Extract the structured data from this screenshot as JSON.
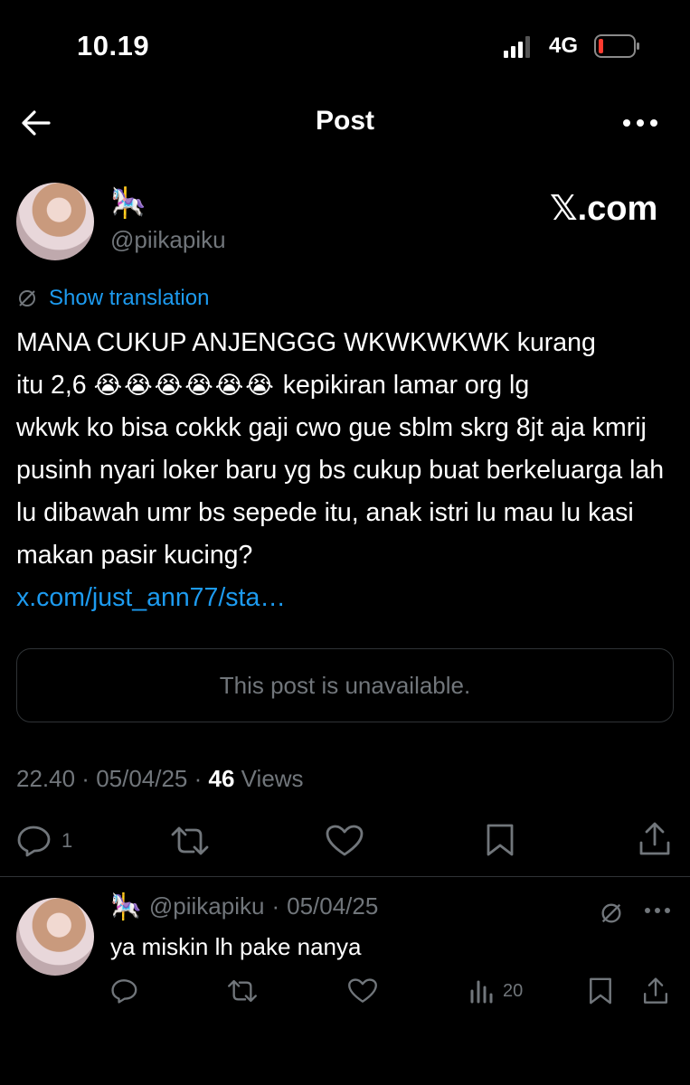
{
  "status_bar": {
    "time": "10.19",
    "network": "4G"
  },
  "header": {
    "title": "Post"
  },
  "post": {
    "author_emoji": "🎠",
    "handle": "@piikapiku",
    "watermark": "𝕏.com",
    "translate_label": "Show translation",
    "text_line1": "MANA CUKUP ANJENGGG WKWKWKWK kurang",
    "text_line2_pre": "itu 2,6",
    "emojis": "😭😭😭😭😭😭",
    "text_line2_post": "kepikiran lamar org lg",
    "text_rest": "wkwk ko bisa cokkk gaji cwo gue sblm skrg 8jt aja kmrij pusinh nyari loker baru yg bs cukup buat berkeluarga lah lu dibawah umr bs sepede itu, anak istri lu mau lu kasi makan pasir kucing?",
    "link": "x.com/just_ann77/sta…",
    "quote_unavailable": "This post is unavailable.",
    "time": "22.40",
    "date": "05/04/25",
    "views_count": "46",
    "views_label": "Views",
    "reply_count": "1"
  },
  "reply": {
    "author_emoji": "🎠",
    "handle": "@piikapiku",
    "date": "05/04/25",
    "text": "ya miskin lh pake nanya",
    "views": "20"
  },
  "colors": {
    "background": "#000000",
    "accent": "#1d9bf0",
    "muted": "#71767b",
    "divider": "#2f3336"
  },
  "icons": [
    "back-arrow-icon",
    "more-icon",
    "translate-icon",
    "reply-icon",
    "retweet-icon",
    "like-icon",
    "bookmark-icon",
    "share-icon",
    "views-icon"
  ]
}
